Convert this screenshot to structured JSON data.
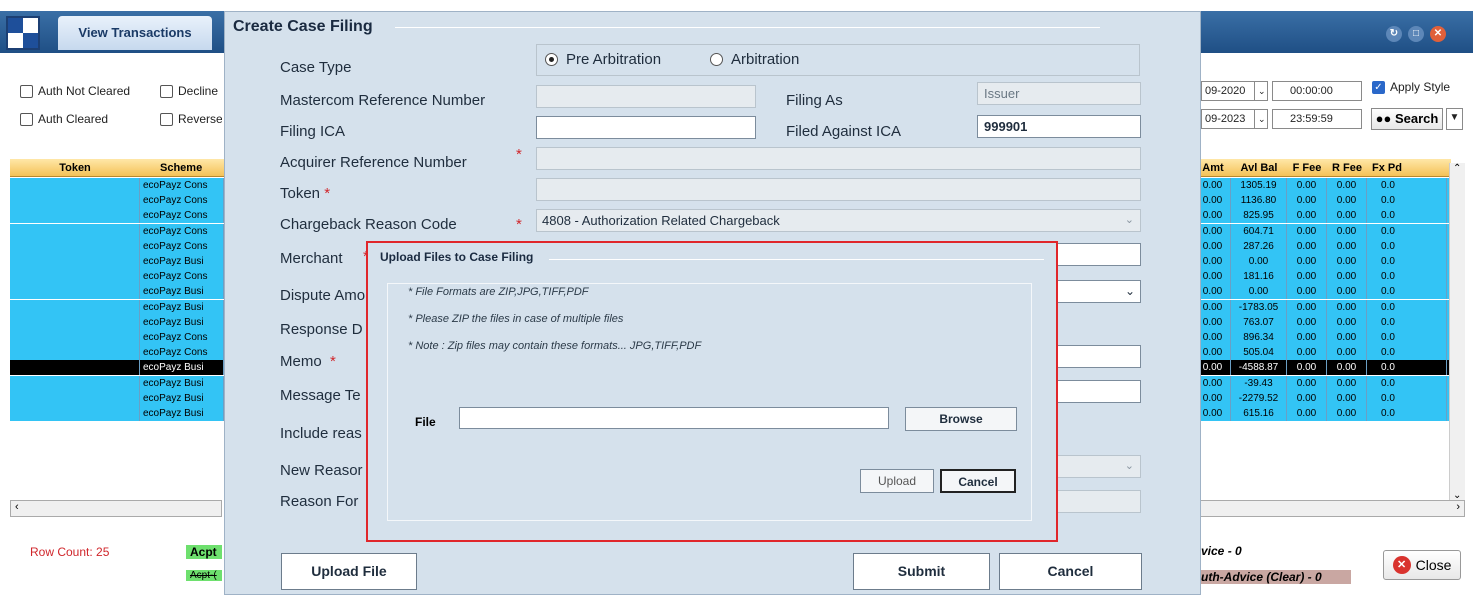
{
  "window": {
    "title": "View Transactions"
  },
  "filters": {
    "auth_not_cleared": "Auth Not Cleared",
    "decline": "Decline",
    "auth_cleared": "Auth Cleared",
    "reverse": "Reverse",
    "date_from": "09-2020",
    "time_from": "00:00:00",
    "date_to": "09-2023",
    "time_to": "23:59:59",
    "apply_style": "Apply Style",
    "search": "Search"
  },
  "left_grid": {
    "columns": [
      "Token",
      "Scheme"
    ],
    "rows": [
      "ecoPayz Cons",
      "ecoPayz Cons",
      "ecoPayz Cons",
      "ecoPayz Cons",
      "ecoPayz Cons",
      "ecoPayz Busi",
      "ecoPayz Cons",
      "ecoPayz Busi",
      "ecoPayz Busi",
      "ecoPayz Busi",
      "ecoPayz Cons",
      "ecoPayz Cons",
      "ecoPayz Busi",
      "ecoPayz Busi",
      "ecoPayz Busi",
      "ecoPayz Busi"
    ],
    "selected_row": 12
  },
  "right_grid": {
    "columns": [
      "Amt",
      "Avl Bal",
      "F Fee",
      "R Fee",
      "Fx Pd"
    ],
    "rows": [
      [
        "0.00",
        "1305.19",
        "0.00",
        "0.00",
        "0.0"
      ],
      [
        "0.00",
        "1136.80",
        "0.00",
        "0.00",
        "0.0"
      ],
      [
        "0.00",
        "825.95",
        "0.00",
        "0.00",
        "0.0"
      ],
      [
        "0.00",
        "604.71",
        "0.00",
        "0.00",
        "0.0"
      ],
      [
        "0.00",
        "287.26",
        "0.00",
        "0.00",
        "0.0"
      ],
      [
        "0.00",
        "0.00",
        "0.00",
        "0.00",
        "0.0"
      ],
      [
        "0.00",
        "181.16",
        "0.00",
        "0.00",
        "0.0"
      ],
      [
        "0.00",
        "0.00",
        "0.00",
        "0.00",
        "0.0"
      ],
      [
        "0.00",
        "-1783.05",
        "0.00",
        "0.00",
        "0.0"
      ],
      [
        "0.00",
        "763.07",
        "0.00",
        "0.00",
        "0.0"
      ],
      [
        "0.00",
        "896.34",
        "0.00",
        "0.00",
        "0.0"
      ],
      [
        "0.00",
        "505.04",
        "0.00",
        "0.00",
        "0.0"
      ],
      [
        "0.00",
        "-4588.87",
        "0.00",
        "0.00",
        "0.0"
      ],
      [
        "0.00",
        "-39.43",
        "0.00",
        "0.00",
        "0.0"
      ],
      [
        "0.00",
        "-2279.52",
        "0.00",
        "0.00",
        "0.0"
      ],
      [
        "0.00",
        "615.16",
        "0.00",
        "0.00",
        "0.0"
      ]
    ]
  },
  "footer": {
    "row_count": "Row Count: 25",
    "legend_acpt": "Acpt",
    "legend_acpt2": "Acpt-(",
    "legend_advice": "vice - 0",
    "legend_auth_advice": "uth-Advice (Clear) - 0",
    "close": "Close"
  },
  "case_dialog": {
    "title": "Create Case Filing",
    "case_type_label": "Case Type",
    "radio_pre_arbitration": "Pre Arbitration",
    "radio_arbitration": "Arbitration",
    "mastercom_ref_label": "Mastercom Reference Number",
    "filing_as_label": "Filing As",
    "filing_as_value": "Issuer",
    "filing_ica_label": "Filing ICA",
    "filed_against_ica_label": "Filed Against ICA",
    "filed_against_ica_value": "999901",
    "acquirer_ref_label": "Acquirer Reference Number",
    "token_label": "Token",
    "chargeback_reason_label": "Chargeback Reason Code",
    "chargeback_reason_value": "4808 - Authorization Related Chargeback",
    "merchant_label": "Merchant",
    "dispute_amount_label": "Dispute Amo",
    "response_label": "Response D",
    "memo_label": "Memo",
    "message_text_label": "Message Te",
    "include_reason_label": "Include reas",
    "new_reason_label": "New Reasor",
    "reason_for_label": "Reason For",
    "upload_file_button": "Upload File",
    "submit_button": "Submit",
    "cancel_button": "Cancel"
  },
  "upload_dialog": {
    "title": "Upload Files to Case Filing",
    "note_formats": "* File Formats are ZIP,JPG,TIFF,PDF",
    "note_zip": "* Please ZIP the files in case of multiple files",
    "note_zip_contains": "* Note : Zip files may contain these formats... JPG,TIFF,PDF",
    "file_label": "File",
    "file_value": "",
    "browse_button": "Browse",
    "upload_button": "Upload",
    "cancel_button": "Cancel"
  },
  "colors": {
    "row_blue": "#33c4f5",
    "highlight_border": "#e0262b",
    "dialog_bg": "#d5e1ec"
  }
}
